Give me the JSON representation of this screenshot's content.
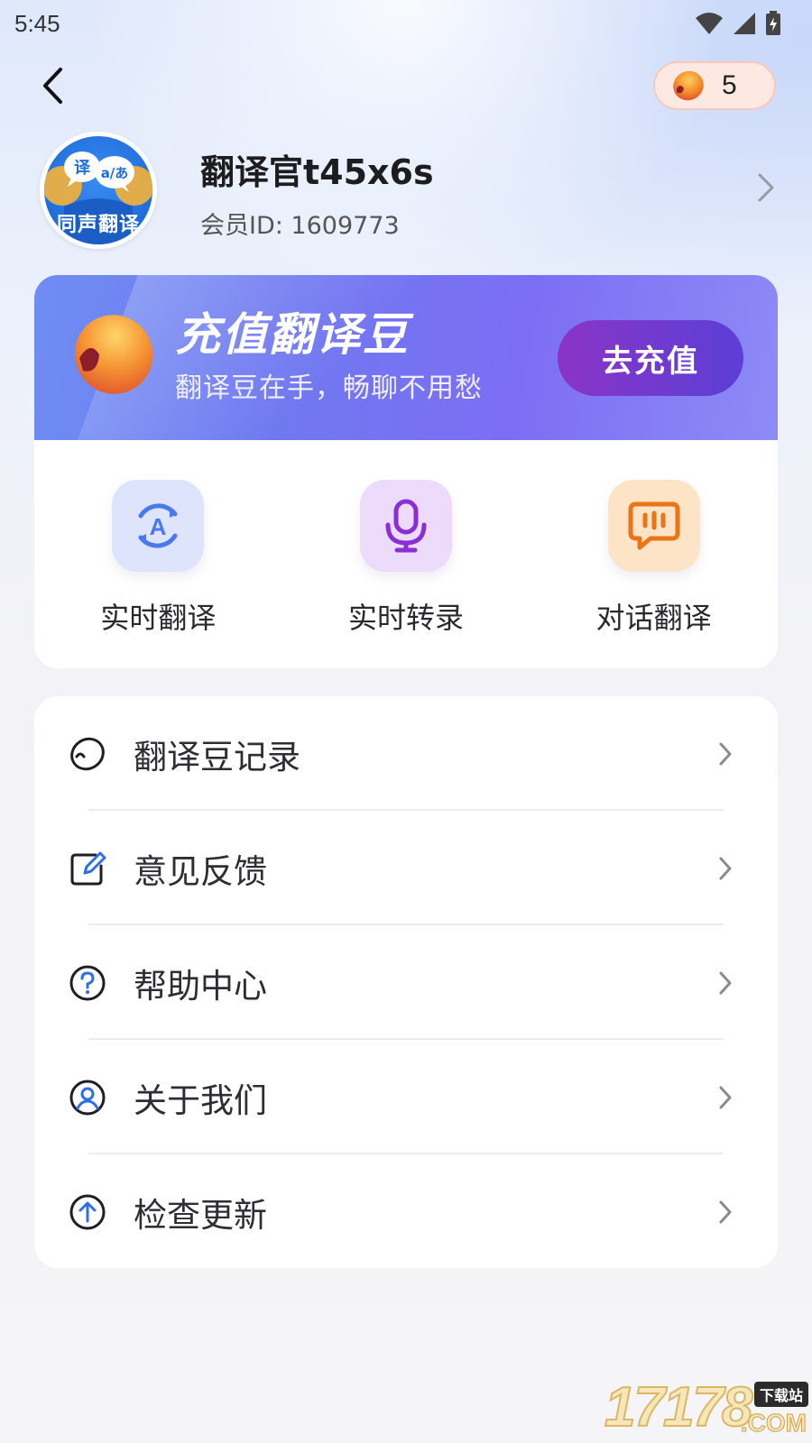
{
  "status_bar": {
    "time": "5:45"
  },
  "header": {
    "beans_count": "5"
  },
  "profile": {
    "name": "翻译官t45x6s",
    "member_id": "会员ID: 1609773",
    "avatar_caption": "同声翻译",
    "avatar_bubble_left": "译",
    "avatar_bubble_right": "a/あ"
  },
  "banner": {
    "title": "充值翻译豆",
    "subtitle": "翻译豆在手，畅聊不用愁",
    "button_label": "去充值"
  },
  "features": [
    {
      "label": "实时翻译",
      "icon": "translate-a-icon",
      "bg": "#dde4fb",
      "color": "#4a78ee"
    },
    {
      "label": "实时转录",
      "icon": "microphone-icon",
      "bg": "#ecdbfb",
      "color": "#8a2fd6"
    },
    {
      "label": "对话翻译",
      "icon": "chat-bubble-icon",
      "bg": "#fde4c6",
      "color": "#ea7416"
    }
  ],
  "menu": [
    {
      "label": "翻译豆记录",
      "icon": "bean-icon"
    },
    {
      "label": "意见反馈",
      "icon": "edit-icon"
    },
    {
      "label": "帮助中心",
      "icon": "help-icon"
    },
    {
      "label": "关于我们",
      "icon": "user-icon"
    },
    {
      "label": "检查更新",
      "icon": "upload-arrow-icon"
    }
  ],
  "watermark": {
    "digits": "17178",
    "tag": "下载站",
    "suffix": ".COM"
  },
  "colors": {
    "accent": "#4a78ee",
    "recharge_button": "#7a36cf",
    "beans_pill_bg": "#fde9e1"
  }
}
